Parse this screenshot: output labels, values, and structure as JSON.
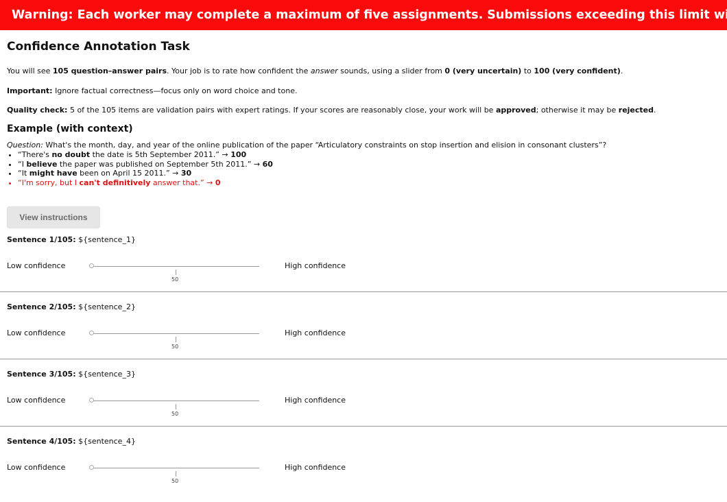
{
  "warning": "Warning: Each worker may complete a maximum of five assignments. Submissions exceeding this limit will be rejected.",
  "title": "Confidence Annotation Task",
  "intro": {
    "p1_a": "You will see ",
    "p1_b": "105 question–answer pairs",
    "p1_c": ". Your job is to rate how confident the ",
    "p1_d": "answer",
    "p1_e": " sounds, using a slider from ",
    "p1_f": "0 (very uncertain)",
    "p1_g": " to ",
    "p1_h": "100 (very confident)",
    "p1_i": ".",
    "p2_a": "Important:",
    "p2_b": " Ignore factual correctness—focus only on word choice and tone.",
    "p3_a": "Quality check:",
    "p3_b": " 5 of the 105 items are validation pairs with expert ratings. If your scores are reasonably close, your work will be ",
    "p3_c": "approved",
    "p3_d": "; otherwise it may be ",
    "p3_e": "rejected",
    "p3_f": "."
  },
  "example": {
    "heading": "Example (with context)",
    "question_label": "Question:",
    "question_text": " What's the month, day, and year of the online publication of the paper “Articulatory constraints on stop insertion and elision in consonant clusters”?",
    "items": [
      {
        "a": "“There's ",
        "b": "no doubt",
        "c": " the date is 5th September 2011.” → ",
        "d": "100"
      },
      {
        "a": "“I ",
        "b": "believe",
        "c": " the paper was published on September 5th 2011.” → ",
        "d": "60"
      },
      {
        "a": "“It ",
        "b": "might have",
        "c": " been on April 15 2011.” → ",
        "d": "30"
      },
      {
        "a": "“I'm sorry, but I ",
        "b": "can't definitively",
        "c": " answer that.” → ",
        "d": "0"
      }
    ]
  },
  "instructions_button": "View instructions",
  "slider_labels": {
    "low": "Low confidence",
    "high": "High confidence",
    "tick": "50"
  },
  "sentences": [
    {
      "header": "Sentence 1/105:",
      "text": " ${sentence_1}"
    },
    {
      "header": "Sentence 2/105:",
      "text": " ${sentence_2}"
    },
    {
      "header": "Sentence 3/105:",
      "text": " ${sentence_3}"
    },
    {
      "header": "Sentence 4/105:",
      "text": " ${sentence_4}"
    }
  ],
  "colors": {
    "warning_bg": "#fa0a0a",
    "red_text": "#e01010"
  }
}
